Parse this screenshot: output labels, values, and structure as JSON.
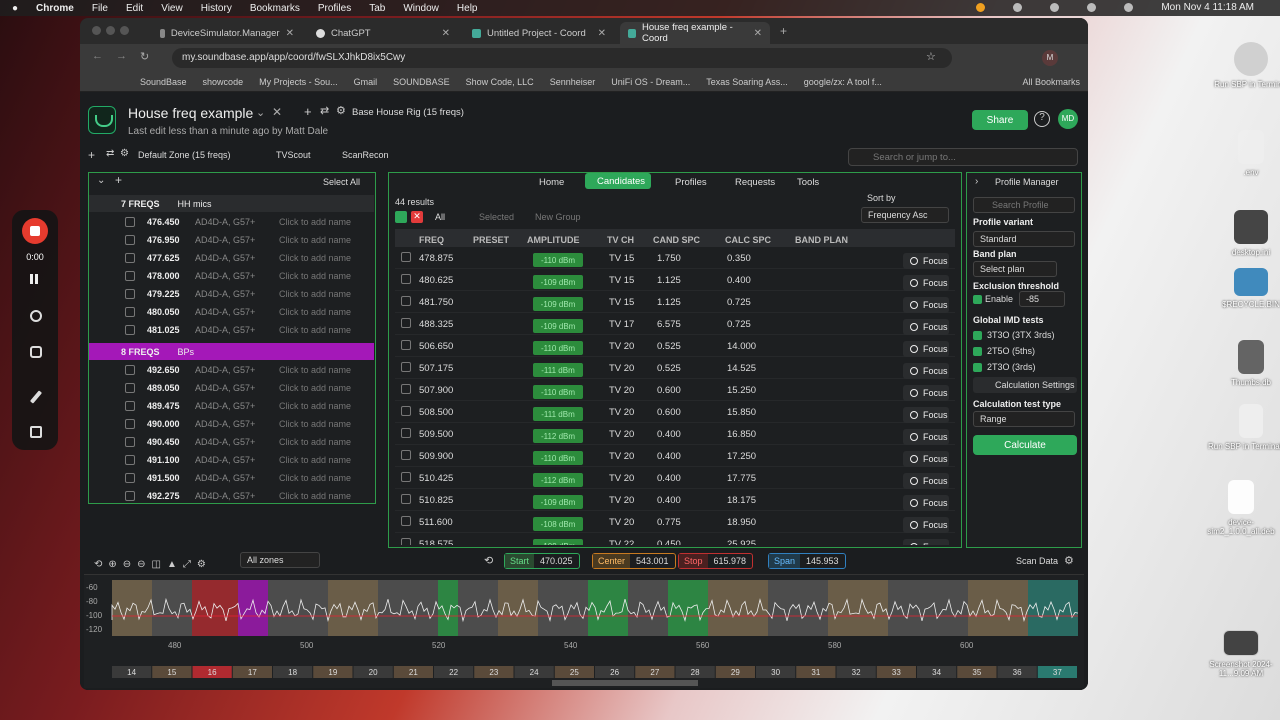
{
  "menubar": {
    "apple": "",
    "app": "Chrome",
    "items": [
      "File",
      "Edit",
      "View",
      "History",
      "Bookmarks",
      "Profiles",
      "Tab",
      "Window",
      "Help"
    ],
    "clock": "Mon Nov 4  11:18 AM"
  },
  "tabs": [
    {
      "label": "DeviceSimulator.Manager"
    },
    {
      "label": "ChatGPT"
    },
    {
      "label": "Untitled Project - Coord"
    },
    {
      "label": "House freq example - Coord"
    }
  ],
  "url": "my.soundbase.app/app/coord/fwSLXJhkD8ix5Cwy",
  "bookmarks": [
    "SoundBase",
    "showcode",
    "My Projects - Sou...",
    "Gmail",
    "SOUNDBASE",
    "Show Code, LLC",
    "Sennheiser",
    "UniFi OS - Dream...",
    "Texas Soaring Ass...",
    "google/zx: A tool f...",
    "All Bookmarks"
  ],
  "project": {
    "title": "House freq example",
    "subtitle": "Last edit less than a minute ago by Matt Dale",
    "rig": "Base House Rig (15 freqs)",
    "share": "Share",
    "avatar": "MD",
    "search_placeholder": "Search or jump to..."
  },
  "zonebar": {
    "zone": "Default Zone (15 freqs)",
    "tvscout": "TVScout",
    "scanrecon": "ScanRecon",
    "select_all": "Select All"
  },
  "groups": [
    {
      "count": "7 FREQS",
      "name": "HH mics",
      "color": "#2a2c2e",
      "rows": [
        "476.450",
        "476.950",
        "477.625",
        "478.000",
        "479.225",
        "480.050",
        "481.025"
      ]
    },
    {
      "count": "8 FREQS",
      "name": "BPs",
      "color": "#a418b8",
      "rows": [
        "492.650",
        "489.050",
        "489.475",
        "490.000",
        "490.450",
        "491.100",
        "491.500",
        "492.275"
      ]
    }
  ],
  "row_device": "AD4D-A, G57+",
  "row_note": "Click to add name",
  "nav": {
    "home": "Home",
    "candidates": "Candidates",
    "profiles": "Profiles",
    "requests": "Requests",
    "tools": "Tools"
  },
  "results": {
    "count": "44 results",
    "all": "All",
    "selected": "Selected",
    "new_group": "New Group",
    "sort_label": "Sort by",
    "sort_value": "Frequency Asc"
  },
  "columns": [
    "FREQ",
    "PRESET",
    "AMPLITUDE",
    "TV CH",
    "CAND SPC",
    "CALC SPC",
    "BAND PLAN"
  ],
  "candidates": [
    {
      "freq": "478.875",
      "amp": "-110 dBm",
      "tv": "TV 15",
      "cand": "1.750",
      "calc": "0.350"
    },
    {
      "freq": "480.625",
      "amp": "-109 dBm",
      "tv": "TV 15",
      "cand": "1.125",
      "calc": "0.400"
    },
    {
      "freq": "481.750",
      "amp": "-109 dBm",
      "tv": "TV 15",
      "cand": "1.125",
      "calc": "0.725"
    },
    {
      "freq": "488.325",
      "amp": "-109 dBm",
      "tv": "TV 17",
      "cand": "6.575",
      "calc": "0.725"
    },
    {
      "freq": "506.650",
      "amp": "-110 dBm",
      "tv": "TV 20",
      "cand": "0.525",
      "calc": "14.000"
    },
    {
      "freq": "507.175",
      "amp": "-111 dBm",
      "tv": "TV 20",
      "cand": "0.525",
      "calc": "14.525"
    },
    {
      "freq": "507.900",
      "amp": "-110 dBm",
      "tv": "TV 20",
      "cand": "0.600",
      "calc": "15.250"
    },
    {
      "freq": "508.500",
      "amp": "-111 dBm",
      "tv": "TV 20",
      "cand": "0.600",
      "calc": "15.850"
    },
    {
      "freq": "509.500",
      "amp": "-112 dBm",
      "tv": "TV 20",
      "cand": "0.400",
      "calc": "16.850"
    },
    {
      "freq": "509.900",
      "amp": "-110 dBm",
      "tv": "TV 20",
      "cand": "0.400",
      "calc": "17.250"
    },
    {
      "freq": "510.425",
      "amp": "-112 dBm",
      "tv": "TV 20",
      "cand": "0.400",
      "calc": "17.775"
    },
    {
      "freq": "510.825",
      "amp": "-109 dBm",
      "tv": "TV 20",
      "cand": "0.400",
      "calc": "18.175"
    },
    {
      "freq": "511.600",
      "amp": "-108 dBm",
      "tv": "TV 20",
      "cand": "0.775",
      "calc": "18.950"
    },
    {
      "freq": "518.575",
      "amp": "-109 dBm",
      "tv": "TV 22",
      "cand": "0.450",
      "calc": "25.925"
    }
  ],
  "focus_label": "Focus",
  "profile": {
    "manager": "Profile Manager",
    "search_placeholder": "Search Profile",
    "variant_label": "Profile variant",
    "variant": "Standard",
    "band_label": "Band plan",
    "band": "Select plan",
    "excl_label": "Exclusion threshold",
    "enable": "Enable",
    "excl_value": "-85",
    "imd_label": "Global IMD tests",
    "imd": [
      "3T3O (3TX 3rds)",
      "2T5O (5ths)",
      "2T3O (3rds)"
    ],
    "calc_settings": "Calculation Settings",
    "test_label": "Calculation test type",
    "test": "Range",
    "calculate": "Calculate"
  },
  "spectrum": {
    "zones": "All zones",
    "start_label": "Start",
    "start": "470.025",
    "center_label": "Center",
    "center": "543.001",
    "stop_label": "Stop",
    "stop": "615.978",
    "span_label": "Span",
    "span": "145.953",
    "scan": "Scan Data",
    "yticks": [
      "-60",
      "-80",
      "-100",
      "-120"
    ],
    "xticks": [
      "480",
      "500",
      "520",
      "540",
      "560",
      "580",
      "600"
    ],
    "channels": [
      "14",
      "15",
      "16",
      "17",
      "18",
      "19",
      "20",
      "21",
      "22",
      "23",
      "24",
      "25",
      "26",
      "27",
      "28",
      "29",
      "30",
      "31",
      "32",
      "33",
      "34",
      "35",
      "36",
      "37"
    ]
  },
  "recorder": {
    "time": "0:00"
  },
  "desktop": [
    {
      "label": "Run SBP in Terminal"
    },
    {
      "label": ".env"
    },
    {
      "label": "desktop.ini"
    },
    {
      "label": "$RECYCLE.BIN"
    },
    {
      "label": "Thumbs.db"
    },
    {
      "label": "Run SBP in Terminal.zip"
    },
    {
      "label": "device-sim2_1.0.0_all.deb"
    },
    {
      "label": "Screenshot 2024-11...9.09 AM"
    }
  ]
}
